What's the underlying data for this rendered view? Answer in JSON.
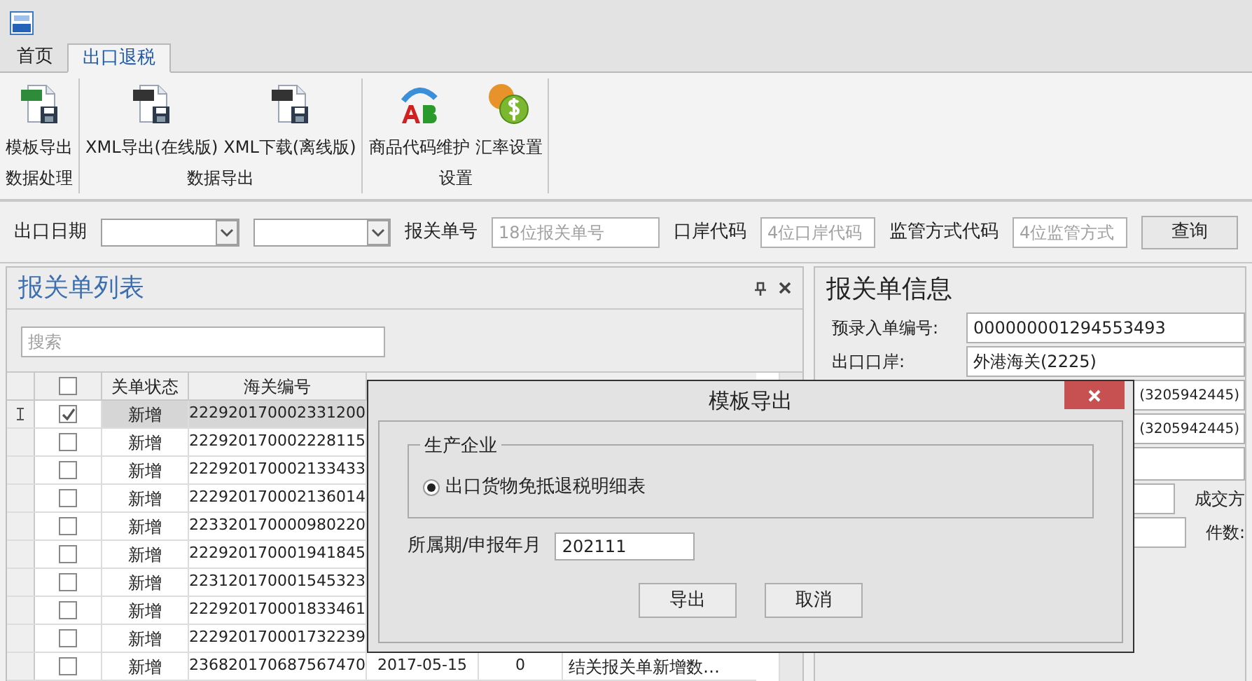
{
  "tabs": [
    {
      "label": "首页",
      "selected": false
    },
    {
      "label": "出口退税",
      "selected": true
    }
  ],
  "ribbon": {
    "groups": [
      {
        "label": "数据处理",
        "buttons": [
          {
            "label": "模板导出",
            "kind": "xls"
          }
        ]
      },
      {
        "label": "数据导出",
        "buttons": [
          {
            "label": "XML导出(在线版)",
            "kind": "xml"
          },
          {
            "label": "XML下载(离线版)",
            "kind": "xml"
          }
        ]
      },
      {
        "label": "设置",
        "buttons": [
          {
            "label": "商品代码维护",
            "kind": "ab"
          },
          {
            "label": "汇率设置",
            "kind": "coin"
          }
        ]
      }
    ]
  },
  "filter_bar": {
    "fields": [
      {
        "kind": "dropdown",
        "label": "出口日期"
      },
      {
        "kind": "dropdown"
      },
      {
        "kind": "text",
        "label": "报关单号",
        "placeholder": "18位报关单号"
      },
      {
        "kind": "text",
        "label": "口岸代码",
        "placeholder": "4位口岸代码"
      },
      {
        "kind": "text",
        "label": "监管方式代码",
        "placeholder": "4位监管方式"
      }
    ],
    "button": "查询"
  },
  "list_panel": {
    "title": "报关单列表",
    "search_placeholder": "搜索",
    "header_checked": false,
    "columns": [
      "关单状态",
      "海关编号"
    ],
    "rows": [
      {
        "selected": true,
        "checked": true,
        "status": "新增",
        "number": "222920170002331200"
      },
      {
        "selected": false,
        "checked": false,
        "status": "新增",
        "number": "222920170002228115"
      },
      {
        "selected": false,
        "checked": false,
        "status": "新增",
        "number": "222920170002133433"
      },
      {
        "selected": false,
        "checked": false,
        "status": "新增",
        "number": "222920170002136014"
      },
      {
        "selected": false,
        "checked": false,
        "status": "新增",
        "number": "223320170000980220"
      },
      {
        "selected": false,
        "checked": false,
        "status": "新增",
        "number": "222920170001941845"
      },
      {
        "selected": false,
        "checked": false,
        "status": "新增",
        "number": "223120170001545323"
      },
      {
        "selected": false,
        "checked": false,
        "status": "新增",
        "number": "222920170001833461"
      },
      {
        "selected": false,
        "checked": false,
        "status": "新增",
        "number": "222920170001732239"
      },
      {
        "selected": false,
        "checked": false,
        "status": "新增",
        "number": "236820170687567470",
        "date": "2017-05-15",
        "count": "0",
        "note": "结关报关单新增数…"
      }
    ]
  },
  "info_panel": {
    "title": "报关单信息",
    "rows": [
      {
        "label": "预录入单编号:",
        "value": "000000001294553493"
      },
      {
        "label": "出口口岸:",
        "value": "外港海关(2225)"
      },
      {
        "value": "(3205942445)"
      },
      {
        "value": "(3205942445)"
      }
    ],
    "side_labels": [
      "成交方",
      "件数:"
    ]
  },
  "dialog": {
    "title": "模板导出",
    "group": {
      "label": "生产企业",
      "options": [
        {
          "label": "出口货物免抵退税明细表",
          "selected": true
        }
      ]
    },
    "period": {
      "label": "所属期/申报年月",
      "value": "202111"
    },
    "buttons": [
      "导出",
      "取消"
    ]
  }
}
